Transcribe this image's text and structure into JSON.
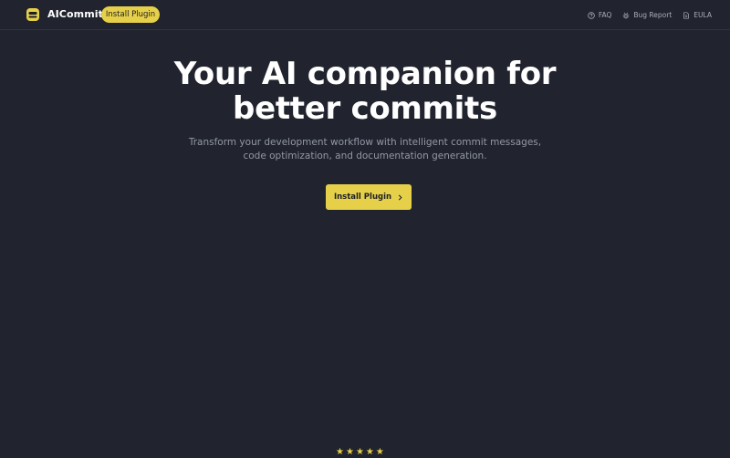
{
  "header": {
    "brand": "AICommit",
    "install_label": "Install Plugin",
    "nav": [
      {
        "label": "FAQ",
        "icon": "question-circle-icon"
      },
      {
        "label": "Bug Report",
        "icon": "bug-icon"
      },
      {
        "label": "EULA",
        "icon": "document-icon"
      }
    ]
  },
  "hero": {
    "title_line1": "Your AI companion for",
    "title_line2": "better commits",
    "subtitle_line1": "Transform your development workflow with intelligent commit messages,",
    "subtitle_line2": "code optimization, and documentation generation.",
    "cta_label": "Install Plugin"
  },
  "rating": {
    "stars": [
      "★",
      "★",
      "★",
      "★",
      "★"
    ]
  },
  "colors": {
    "background": "#21242e",
    "accent": "#e6d04a",
    "muted_text": "#9398a6"
  }
}
